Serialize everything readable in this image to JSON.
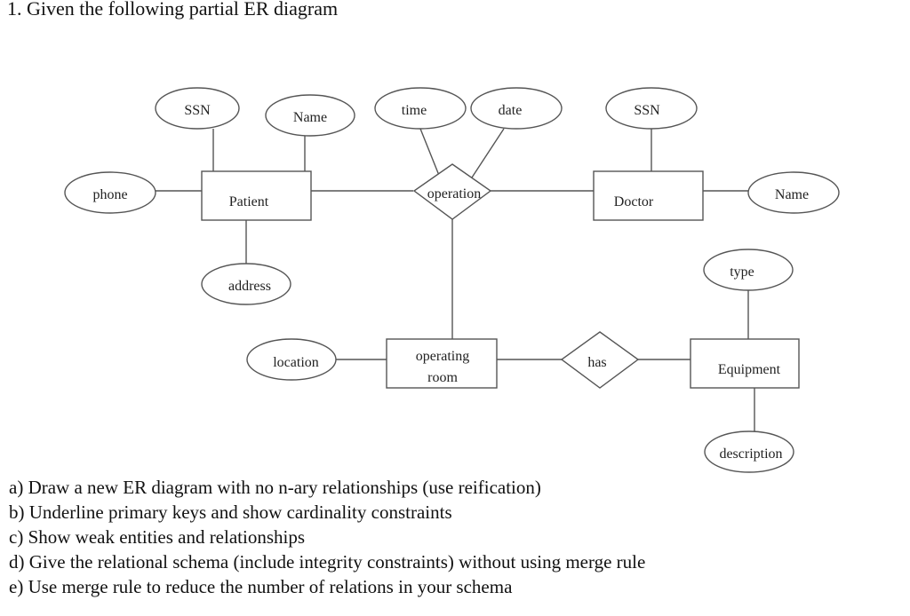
{
  "title": "1. Given the following partial ER diagram",
  "diagram": {
    "entities": {
      "patient": "Patient",
      "doctor": "Doctor",
      "operating_room": [
        "operating",
        "room"
      ],
      "equipment": "Equipment"
    },
    "relationships": {
      "operation": "operation",
      "has": "has"
    },
    "attributes": {
      "patient_ssn": "SSN",
      "patient_name": "Name",
      "patient_phone": "phone",
      "patient_address": "address",
      "operation_time": "time",
      "operation_date": "date",
      "doctor_ssn": "SSN",
      "doctor_name": "Name",
      "room_location": "location",
      "equipment_type": "type",
      "equipment_description": "description"
    }
  },
  "questions": [
    "a) Draw a new ER diagram with no n-ary relationships (use reification)",
    "b) Underline primary keys and show cardinality constraints",
    "c) Show weak entities and relationships",
    "d) Give the relational schema (include integrity constraints) without using merge rule",
    "e) Use merge rule to reduce the number of relations in your schema"
  ]
}
